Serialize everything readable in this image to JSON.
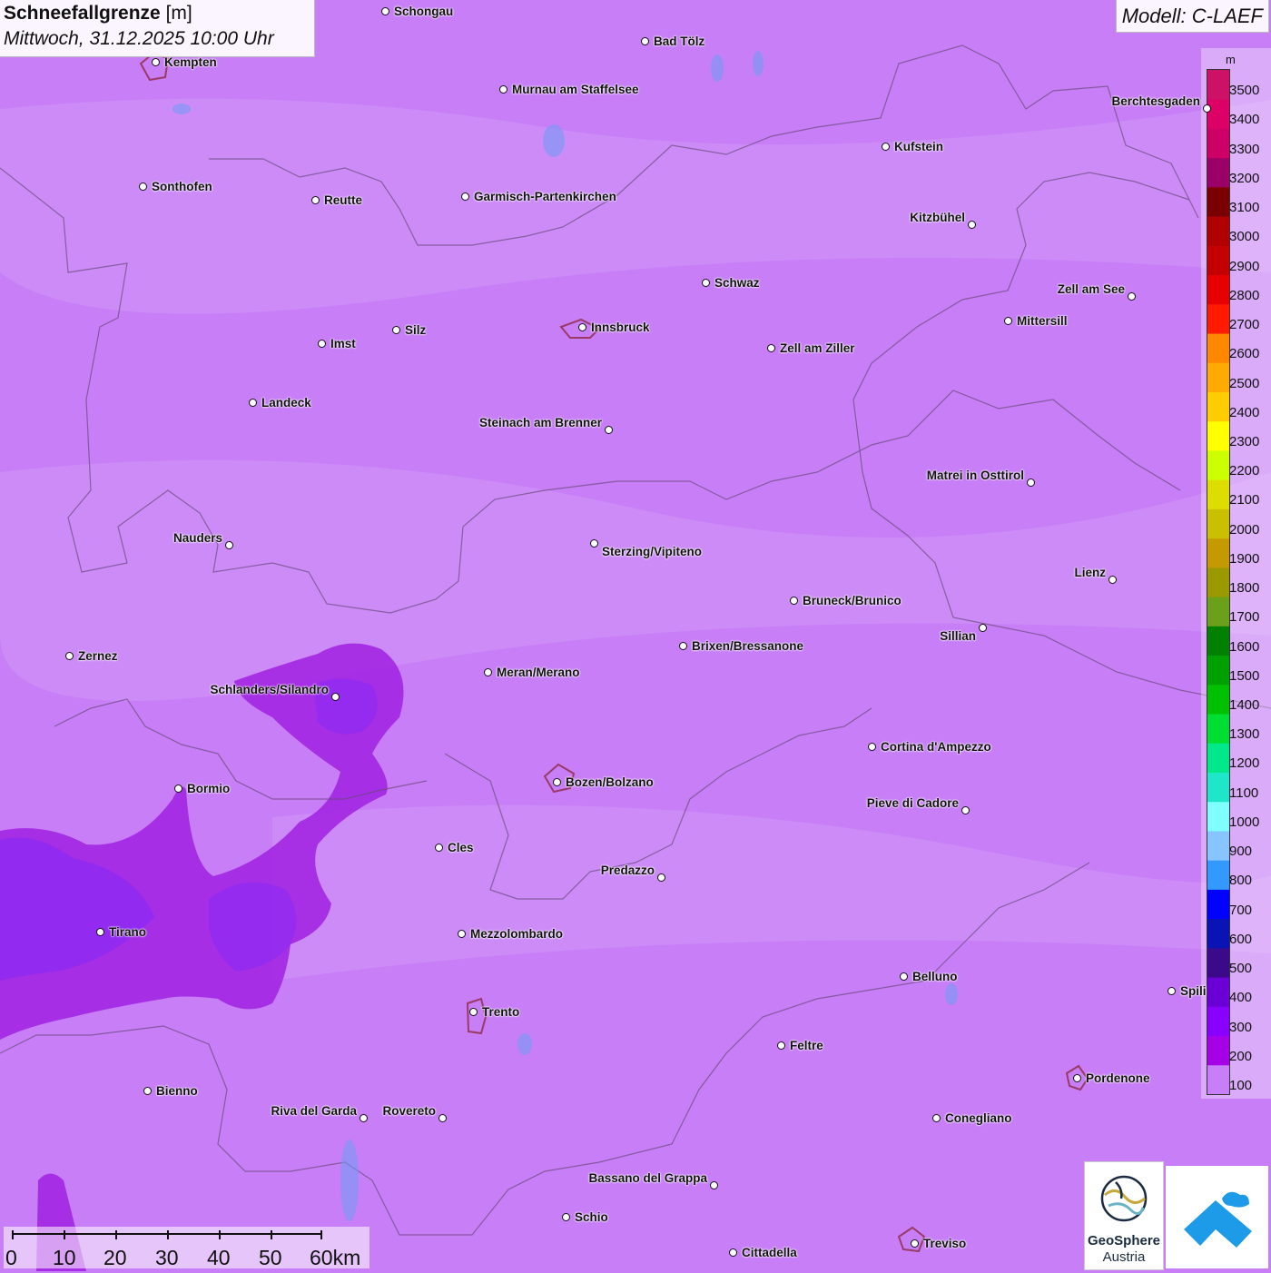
{
  "title": {
    "main": "Schneefallgrenze",
    "unit": "[m]",
    "datetime": "Mittwoch, 31.12.2025 10:00 Uhr"
  },
  "model": "Modell: C-LAEF",
  "legend": {
    "unit": "m",
    "bands": [
      {
        "label": "100",
        "color": "#c77ef6"
      },
      {
        "label": "200",
        "color": "#a600e6"
      },
      {
        "label": "300",
        "color": "#8a00ff"
      },
      {
        "label": "400",
        "color": "#6a00d5"
      },
      {
        "label": "500",
        "color": "#3a0a8a"
      },
      {
        "label": "600",
        "color": "#0a14b5"
      },
      {
        "label": "700",
        "color": "#0000ff"
      },
      {
        "label": "800",
        "color": "#3399ff"
      },
      {
        "label": "900",
        "color": "#88c4ff"
      },
      {
        "label": "1000",
        "color": "#80ffff"
      },
      {
        "label": "1100",
        "color": "#1fe6c8"
      },
      {
        "label": "1200",
        "color": "#00e88a"
      },
      {
        "label": "1300",
        "color": "#00dd33"
      },
      {
        "label": "1400",
        "color": "#00c000"
      },
      {
        "label": "1500",
        "color": "#00a000"
      },
      {
        "label": "1600",
        "color": "#008000"
      },
      {
        "label": "1700",
        "color": "#6aa01a"
      },
      {
        "label": "1800",
        "color": "#9a9a00"
      },
      {
        "label": "1900",
        "color": "#c59a00"
      },
      {
        "label": "2000",
        "color": "#c8c000"
      },
      {
        "label": "2100",
        "color": "#dddd00"
      },
      {
        "label": "2200",
        "color": "#ccff00"
      },
      {
        "label": "2300",
        "color": "#ffff00"
      },
      {
        "label": "2400",
        "color": "#ffcc00"
      },
      {
        "label": "2500",
        "color": "#ffaa00"
      },
      {
        "label": "2600",
        "color": "#ff8800"
      },
      {
        "label": "2700",
        "color": "#ff1a00"
      },
      {
        "label": "2800",
        "color": "#e60000"
      },
      {
        "label": "2900",
        "color": "#c40000"
      },
      {
        "label": "3000",
        "color": "#b00000"
      },
      {
        "label": "3100",
        "color": "#7a0000"
      },
      {
        "label": "3200",
        "color": "#9a0066"
      },
      {
        "label": "3300",
        "color": "#cc0066"
      },
      {
        "label": "3400",
        "color": "#dd0066"
      },
      {
        "label": "3500",
        "color": "#cc1166"
      }
    ]
  },
  "cities": [
    {
      "name": "Schongau"
    },
    {
      "name": "Bad Tölz"
    },
    {
      "name": "Kempten"
    },
    {
      "name": "Murnau am Staffelsee"
    },
    {
      "name": "Berchtesgaden"
    },
    {
      "name": "Kufstein"
    },
    {
      "name": "Sonthofen"
    },
    {
      "name": "Reutte"
    },
    {
      "name": "Garmisch-Partenkirchen"
    },
    {
      "name": "Kitzbühel"
    },
    {
      "name": "Schwaz"
    },
    {
      "name": "Zell am See"
    },
    {
      "name": "Mittersill"
    },
    {
      "name": "Innsbruck"
    },
    {
      "name": "Silz"
    },
    {
      "name": "Imst"
    },
    {
      "name": "Zell am Ziller"
    },
    {
      "name": "Landeck"
    },
    {
      "name": "Steinach am Brenner"
    },
    {
      "name": "Matrei in Osttirol"
    },
    {
      "name": "Nauders"
    },
    {
      "name": "Sterzing/Vipiteno"
    },
    {
      "name": "Lienz"
    },
    {
      "name": "Bruneck/Brunico"
    },
    {
      "name": "Sillian"
    },
    {
      "name": "Zernez"
    },
    {
      "name": "Brixen/Bressanone"
    },
    {
      "name": "Meran/Merano"
    },
    {
      "name": "Schlanders/Silandro"
    },
    {
      "name": "Cortina d'Ampezzo"
    },
    {
      "name": "Bozen/Bolzano"
    },
    {
      "name": "Bormio"
    },
    {
      "name": "Pieve di Cadore"
    },
    {
      "name": "Cles"
    },
    {
      "name": "Predazzo"
    },
    {
      "name": "Tirano"
    },
    {
      "name": "Mezzolombardo"
    },
    {
      "name": "Belluno"
    },
    {
      "name": "Spili"
    },
    {
      "name": "Trento"
    },
    {
      "name": "Feltre"
    },
    {
      "name": "Pordenone"
    },
    {
      "name": "Bienno"
    },
    {
      "name": "Riva del Garda"
    },
    {
      "name": "Rovereto"
    },
    {
      "name": "Conegliano"
    },
    {
      "name": "Bassano del Grappa"
    },
    {
      "name": "Schio"
    },
    {
      "name": "Treviso"
    },
    {
      "name": "Cittadella"
    }
  ],
  "scale": {
    "labels": [
      "0",
      "10",
      "20",
      "30",
      "40",
      "50",
      "60km"
    ]
  },
  "logos": {
    "geosphere_line1": "GeoSphere",
    "geosphere_line2": "Austria"
  }
}
